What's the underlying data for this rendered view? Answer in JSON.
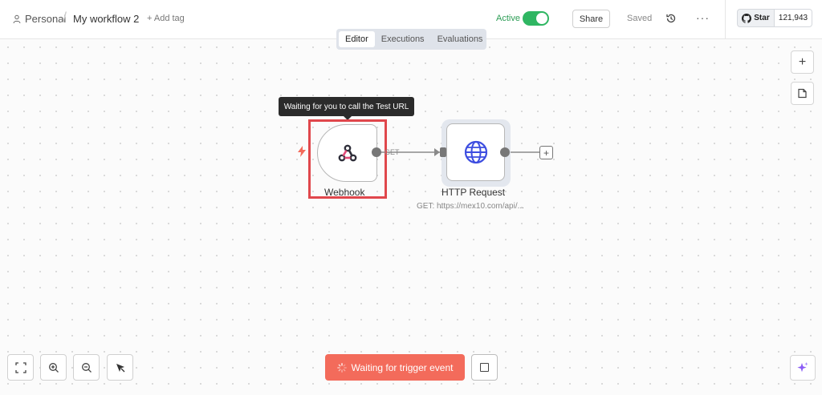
{
  "header": {
    "breadcrumb_project": "Personal",
    "breadcrumb_separator": "/",
    "workflow_name": "My workflow 2",
    "add_tag_label": "+ Add tag",
    "active_label": "Active",
    "active_state": true,
    "share_label": "Share",
    "saved_label": "Saved",
    "more_label": "···",
    "github_star_label": "Star",
    "github_star_count": "121,943"
  },
  "tabs": [
    {
      "label": "Editor",
      "active": true
    },
    {
      "label": "Executions",
      "active": false
    },
    {
      "label": "Evaluations",
      "active": false
    }
  ],
  "canvas": {
    "zoom_in_label": "+",
    "tooltip": "Waiting for you to call the Test URL",
    "nodes": {
      "webhook": {
        "label": "Webhook",
        "icon": "webhook-icon"
      },
      "http": {
        "label": "HTTP Request",
        "subtitle": "GET: https://mex10.com/api/...",
        "icon": "globe-icon"
      }
    },
    "edge_label": "GET",
    "add_node_label": "+",
    "trigger_button_label": "Waiting for trigger event"
  },
  "colors": {
    "accent": "#f36b5b",
    "active_toggle": "#2fb662",
    "highlight": "#e0474c",
    "globe": "#3d4de0"
  }
}
